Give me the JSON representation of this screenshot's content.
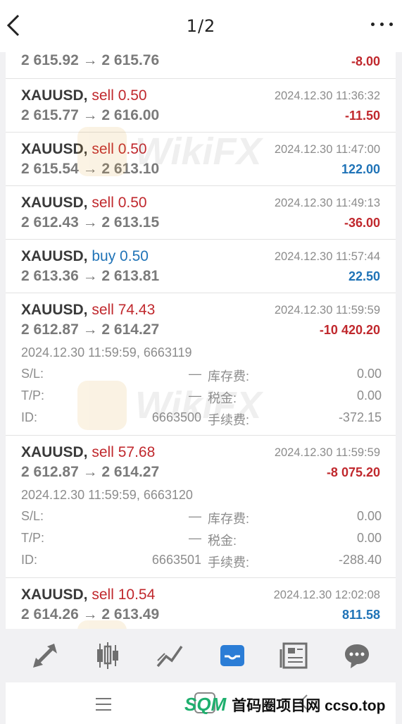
{
  "header": {
    "page_indicator": "1/2"
  },
  "trades": [
    {
      "prices": "2 615.92 → 2 615.76",
      "profit": "-8.00",
      "sign": "neg"
    },
    {
      "symbol": "XAUUSD,",
      "side": "sell 0.50",
      "side_type": "sell",
      "time": "2024.12.30 11:36:32",
      "prices": "2 615.77 → 2 616.00",
      "profit": "-11.50",
      "sign": "neg"
    },
    {
      "symbol": "XAUUSD,",
      "side": "sell 0.50",
      "side_type": "sell",
      "time": "2024.12.30 11:47:00",
      "prices": "2 615.54 → 2 613.10",
      "profit": "122.00",
      "sign": "pos"
    },
    {
      "symbol": "XAUUSD,",
      "side": "sell 0.50",
      "side_type": "sell",
      "time": "2024.12.30 11:49:13",
      "prices": "2 612.43 → 2 613.15",
      "profit": "-36.00",
      "sign": "neg"
    },
    {
      "symbol": "XAUUSD,",
      "side": "buy 0.50",
      "side_type": "buy",
      "time": "2024.12.30 11:57:44",
      "prices": "2 613.36 → 2 613.81",
      "profit": "22.50",
      "sign": "pos"
    },
    {
      "symbol": "XAUUSD,",
      "side": "sell 74.43",
      "side_type": "sell",
      "time": "2024.12.30 11:59:59",
      "prices": "2 612.87 → 2 614.27",
      "profit": "-10 420.20",
      "sign": "neg",
      "detail": {
        "date_order": "2024.12.30 11:59:59, 6663119",
        "sl_label": "S/L:",
        "sl_value": "—",
        "swap_label": "库存费:",
        "swap_value": "0.00",
        "tp_label": "T/P:",
        "tp_value": "—",
        "tax_label": "税金:",
        "tax_value": "0.00",
        "id_label": "ID:",
        "id_value": "6663500",
        "fee_label": "手续费:",
        "fee_value": "-372.15"
      }
    },
    {
      "symbol": "XAUUSD,",
      "side": "sell 57.68",
      "side_type": "sell",
      "time": "2024.12.30 11:59:59",
      "prices": "2 612.87 → 2 614.27",
      "profit": "-8 075.20",
      "sign": "neg",
      "detail": {
        "date_order": "2024.12.30 11:59:59, 6663120",
        "sl_label": "S/L:",
        "sl_value": "—",
        "swap_label": "库存费:",
        "swap_value": "0.00",
        "tp_label": "T/P:",
        "tp_value": "—",
        "tax_label": "税金:",
        "tax_value": "0.00",
        "id_label": "ID:",
        "id_value": "6663501",
        "fee_label": "手续费:",
        "fee_value": "-288.40"
      }
    },
    {
      "symbol": "XAUUSD,",
      "side": "sell 10.54",
      "side_type": "sell",
      "time": "2024.12.30 12:02:08",
      "prices": "2 614.26 → 2 613.49",
      "profit": "811.58",
      "sign": "pos"
    }
  ],
  "toolbar": {
    "items": [
      {
        "icon": "trade-arrows-icon",
        "active": false
      },
      {
        "icon": "candlestick-chart-icon",
        "active": false
      },
      {
        "icon": "trend-line-icon",
        "active": false
      },
      {
        "icon": "history-inbox-icon",
        "active": true
      },
      {
        "icon": "news-icon",
        "active": false
      },
      {
        "icon": "chat-icon",
        "active": false
      }
    ],
    "active_color": "#2b7dd6",
    "inactive_color": "#6f6f6f"
  },
  "watermark": {
    "text": "WikiFX"
  },
  "brand": {
    "mark": "SQM",
    "text": "首码圈项目网 ccso.top"
  }
}
